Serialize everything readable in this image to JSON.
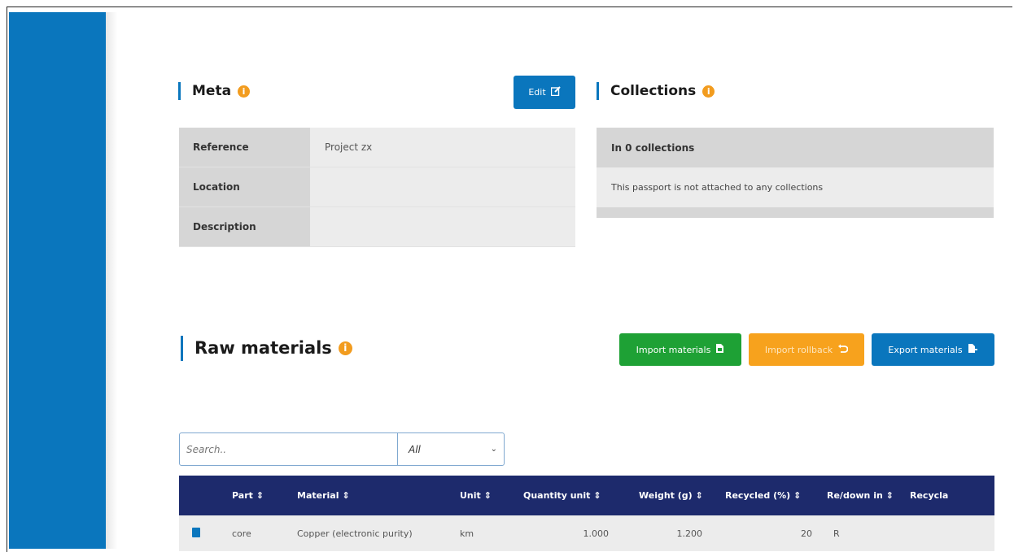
{
  "colors": {
    "primary": "#0a76bd",
    "success": "#1ea135",
    "warning": "#f7a21d",
    "info_badge": "#f29c1f",
    "table_header": "#1d2a6c"
  },
  "meta": {
    "title": "Meta",
    "info_icon": "i",
    "edit_label": "Edit",
    "edit_icon": "edit-icon",
    "rows": [
      {
        "key": "Reference",
        "value": "Project zx"
      },
      {
        "key": "Location",
        "value": ""
      },
      {
        "key": "Description",
        "value": ""
      }
    ]
  },
  "collections": {
    "title": "Collections",
    "info_icon": "i",
    "header": "In 0 collections",
    "body": "This passport is not attached to any collections"
  },
  "raw_materials": {
    "title": "Raw materials",
    "info_icon": "i",
    "import_label": "Import materials",
    "rollback_label": "Import rollback",
    "export_label": "Export materials",
    "search_placeholder": "Search..",
    "filter_value": "All"
  },
  "table": {
    "columns": [
      "Part",
      "Material",
      "Unit",
      "Quantity unit",
      "Weight (g)",
      "Recycled (%)",
      "Re/down in",
      "Recycla"
    ],
    "rows": [
      {
        "part": "core",
        "material": "Copper (electronic purity)",
        "unit": "km",
        "quantity": "1.000",
        "weight": "1.200",
        "recycled": "20",
        "redown": "R",
        "recyclable": ""
      }
    ]
  }
}
